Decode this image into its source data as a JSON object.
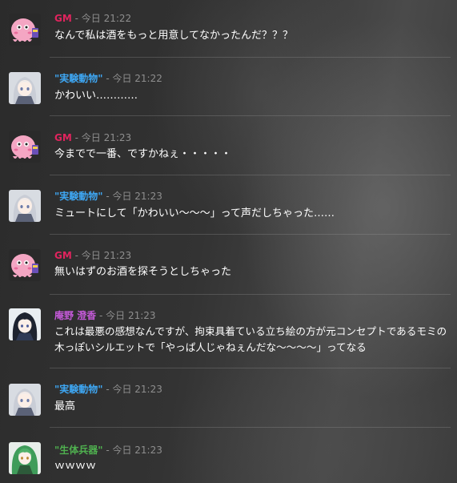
{
  "colors": {
    "gm": "#e0245e",
    "experiment": "#3ea6f2",
    "anno": "#c55ad9",
    "weapon": "#4fb04f"
  },
  "messages": [
    {
      "name": "GM",
      "color": "#e0245e",
      "meta": " - 今日 21:22",
      "text": "なんで私は酒をもっと用意してなかったんだ？？？",
      "avatar": "gm-octopus"
    },
    {
      "name": "\"実験動物\"",
      "color": "#3ea6f2",
      "meta": " - 今日 21:22",
      "text": "かわいい…………",
      "avatar": "silver-hair-girl"
    },
    {
      "name": "GM",
      "color": "#e0245e",
      "meta": " - 今日 21:23",
      "text": "今までで一番、ですかねぇ・・・・・",
      "avatar": "gm-octopus"
    },
    {
      "name": "\"実験動物\"",
      "color": "#3ea6f2",
      "meta": " - 今日 21:23",
      "text": "ミュートにして「かわいい～～～」って声だしちゃった……",
      "avatar": "silver-hair-girl"
    },
    {
      "name": "GM",
      "color": "#e0245e",
      "meta": " - 今日 21:23",
      "text": "無いはずのお酒を探そうとしちゃった",
      "avatar": "gm-octopus"
    },
    {
      "name": "庵野 澄香",
      "color": "#c55ad9",
      "meta": " - 今日 21:23",
      "text": "これは最悪の感想なんですが、拘束具着ている立ち絵の方が元コンセプトであるモミの木っぽいシルエットで「やっぱ人じゃねぇんだな～～～～」ってなる",
      "avatar": "dark-hair-girl"
    },
    {
      "name": "\"実験動物\"",
      "color": "#3ea6f2",
      "meta": " - 今日 21:23",
      "text": "最高",
      "avatar": "silver-hair-girl"
    },
    {
      "name": "\"生体兵器\"",
      "color": "#4fb04f",
      "meta": " - 今日 21:23",
      "text": "ｗｗｗｗ",
      "avatar": "green-hair-character"
    }
  ]
}
